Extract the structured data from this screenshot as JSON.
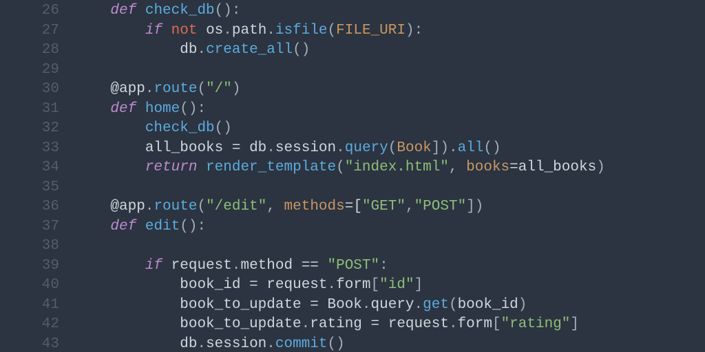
{
  "gutter": {
    "start": 26,
    "end": 43
  },
  "lines": {
    "l26": {
      "indent": "    ",
      "tokens": [
        [
          "def",
          "def "
        ],
        [
          "fn",
          "check_db"
        ],
        [
          "punc",
          "():"
        ]
      ]
    },
    "l27": {
      "indent": "        ",
      "tokens": [
        [
          "kw",
          "if "
        ],
        [
          "not",
          "not "
        ],
        [
          "obj",
          "os"
        ],
        [
          "punc",
          "."
        ],
        [
          "obj",
          "path"
        ],
        [
          "punc",
          "."
        ],
        [
          "call",
          "isfile"
        ],
        [
          "punc",
          "("
        ],
        [
          "const",
          "FILE_URI"
        ],
        [
          "punc",
          "):"
        ]
      ]
    },
    "l28": {
      "indent": "            ",
      "tokens": [
        [
          "obj",
          "db"
        ],
        [
          "punc",
          "."
        ],
        [
          "call",
          "create_all"
        ],
        [
          "punc",
          "()"
        ]
      ]
    },
    "l29": {
      "indent": "",
      "tokens": []
    },
    "l30": {
      "indent": "    ",
      "tokens": [
        [
          "dec",
          "@app"
        ],
        [
          "punc",
          "."
        ],
        [
          "decfn",
          "route"
        ],
        [
          "punc",
          "("
        ],
        [
          "str",
          "\"/\""
        ],
        [
          "punc",
          ")"
        ]
      ]
    },
    "l31": {
      "indent": "    ",
      "tokens": [
        [
          "def",
          "def "
        ],
        [
          "fn",
          "home"
        ],
        [
          "punc",
          "():"
        ]
      ]
    },
    "l32": {
      "indent": "        ",
      "tokens": [
        [
          "call",
          "check_db"
        ],
        [
          "punc",
          "()"
        ]
      ]
    },
    "l33": {
      "indent": "        ",
      "tokens": [
        [
          "obj",
          "all_books "
        ],
        [
          "op",
          "= "
        ],
        [
          "obj",
          "db"
        ],
        [
          "punc",
          "."
        ],
        [
          "obj",
          "session"
        ],
        [
          "punc",
          "."
        ],
        [
          "call",
          "query"
        ],
        [
          "punc",
          "("
        ],
        [
          "const",
          "Book"
        ],
        [
          "punc",
          "])."
        ],
        [
          "call",
          "all"
        ],
        [
          "punc",
          "()"
        ]
      ]
    },
    "l34": {
      "indent": "        ",
      "tokens": [
        [
          "kw",
          "return "
        ],
        [
          "call",
          "render_template"
        ],
        [
          "punc",
          "("
        ],
        [
          "str",
          "\"index.html\""
        ],
        [
          "punc",
          ", "
        ],
        [
          "param",
          "books"
        ],
        [
          "op",
          "="
        ],
        [
          "obj",
          "all_books"
        ],
        [
          "punc",
          ")"
        ]
      ]
    },
    "l35": {
      "indent": "",
      "tokens": []
    },
    "l36": {
      "indent": "    ",
      "tokens": [
        [
          "dec",
          "@app"
        ],
        [
          "punc",
          "."
        ],
        [
          "decfn",
          "route"
        ],
        [
          "punc",
          "("
        ],
        [
          "str",
          "\"/edit\""
        ],
        [
          "punc",
          ", "
        ],
        [
          "param",
          "methods"
        ],
        [
          "op",
          "=["
        ],
        [
          "str",
          "\"GET\""
        ],
        [
          "punc",
          ","
        ],
        [
          "str",
          "\"POST\""
        ],
        [
          "punc",
          "])"
        ]
      ]
    },
    "l37": {
      "indent": "    ",
      "tokens": [
        [
          "def",
          "def "
        ],
        [
          "fn",
          "edit"
        ],
        [
          "punc",
          "():"
        ]
      ]
    },
    "l38": {
      "indent": "",
      "tokens": []
    },
    "l39": {
      "indent": "        ",
      "tokens": [
        [
          "kw",
          "if "
        ],
        [
          "obj",
          "request"
        ],
        [
          "punc",
          "."
        ],
        [
          "obj",
          "method "
        ],
        [
          "op",
          "== "
        ],
        [
          "str",
          "\"POST\""
        ],
        [
          "punc",
          ":"
        ]
      ]
    },
    "l40": {
      "indent": "            ",
      "tokens": [
        [
          "obj",
          "book_id "
        ],
        [
          "op",
          "= "
        ],
        [
          "obj",
          "request"
        ],
        [
          "punc",
          "."
        ],
        [
          "obj",
          "form"
        ],
        [
          "punc",
          "["
        ],
        [
          "str",
          "\"id\""
        ],
        [
          "punc",
          "]"
        ]
      ]
    },
    "l41": {
      "indent": "            ",
      "tokens": [
        [
          "obj",
          "book_to_update "
        ],
        [
          "op",
          "= "
        ],
        [
          "obj",
          "Book"
        ],
        [
          "punc",
          "."
        ],
        [
          "obj",
          "query"
        ],
        [
          "punc",
          "."
        ],
        [
          "call",
          "get"
        ],
        [
          "punc",
          "("
        ],
        [
          "obj",
          "book_id"
        ],
        [
          "punc",
          ")"
        ]
      ]
    },
    "l42": {
      "indent": "            ",
      "tokens": [
        [
          "obj",
          "book_to_update"
        ],
        [
          "punc",
          "."
        ],
        [
          "obj",
          "rating "
        ],
        [
          "op",
          "= "
        ],
        [
          "obj",
          "request"
        ],
        [
          "punc",
          "."
        ],
        [
          "obj",
          "form"
        ],
        [
          "punc",
          "["
        ],
        [
          "str",
          "\"rating\""
        ],
        [
          "punc",
          "]"
        ]
      ]
    },
    "l43": {
      "indent": "            ",
      "tokens": [
        [
          "obj",
          "db"
        ],
        [
          "punc",
          "."
        ],
        [
          "obj",
          "session"
        ],
        [
          "punc",
          "."
        ],
        [
          "call",
          "commit"
        ],
        [
          "punc",
          "()"
        ]
      ]
    }
  }
}
